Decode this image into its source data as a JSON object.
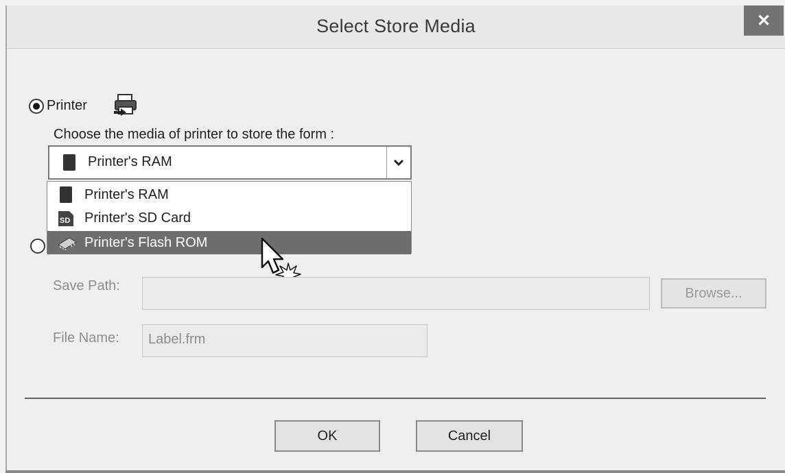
{
  "window": {
    "title": "Select Store Media",
    "close_glyph": "✕"
  },
  "printer_option": {
    "label": "Printer",
    "icon": "printer-icon",
    "instruction": "Choose the media of printer to store the form :",
    "selected_value": "Printer's RAM",
    "options": [
      {
        "label": "Printer's RAM",
        "icon": "ram-chip-icon"
      },
      {
        "label": "Printer's SD Card",
        "icon": "sd-card-icon"
      },
      {
        "label": "Printer's Flash ROM",
        "icon": "flash-rom-icon",
        "highlighted": true
      }
    ]
  },
  "file_option": {
    "save_path_label": "Save Path:",
    "save_path_value": "",
    "browse_label": "Browse...",
    "file_name_label": "File Name:",
    "file_name_value": "Label.frm"
  },
  "footer": {
    "ok_label": "OK",
    "cancel_label": "Cancel"
  }
}
